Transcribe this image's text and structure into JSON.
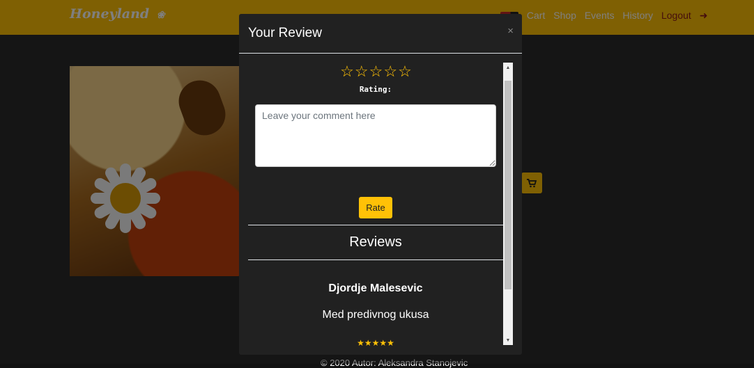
{
  "navbar": {
    "brand": "Honeyland",
    "links": {
      "cart": "Cart",
      "shop": "Shop",
      "events": "Events",
      "history": "History",
      "logout": "Logout"
    }
  },
  "footer": {
    "text": "© 2020 Autor: Aleksandra Stanojevic"
  },
  "modal": {
    "title": "Your Review",
    "close_symbol": "×",
    "rating_label": "Rating:",
    "stars": [
      "☆",
      "☆",
      "☆",
      "☆",
      "☆"
    ],
    "comment_placeholder": "Leave your comment here",
    "rate_button": "Rate",
    "reviews_heading": "Reviews",
    "reviews": [
      {
        "author": "Djordje Malesevic",
        "comment": "Med predivnog ukusa",
        "stars_rating": 5
      }
    ]
  },
  "colors": {
    "accent": "#ffc107",
    "modal_bg": "#212121",
    "logout": "#8b1a1a"
  },
  "icons": [
    "bees-icon",
    "flag-icon",
    "cart-icon",
    "logout-icon",
    "close-icon",
    "star-outline-icon",
    "star-filled-icon",
    "cart-button-icon"
  ]
}
